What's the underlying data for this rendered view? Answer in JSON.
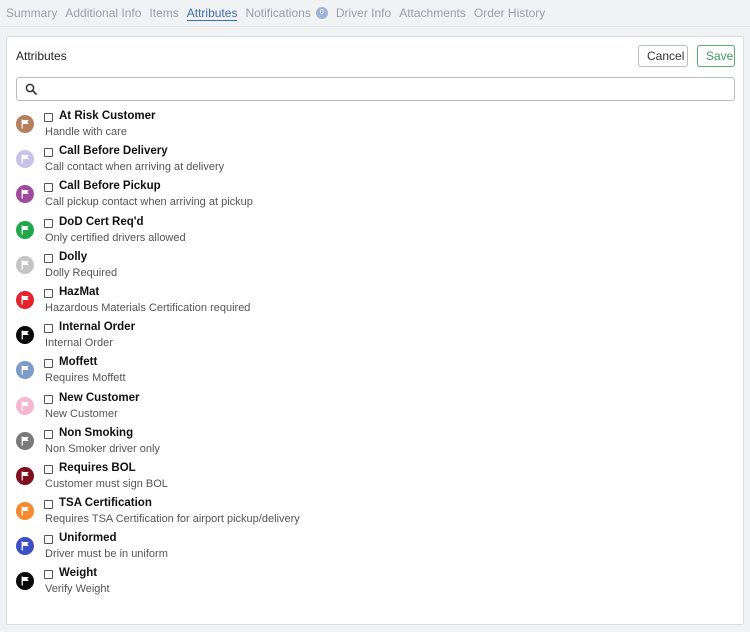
{
  "tabs": [
    {
      "label": "Summary"
    },
    {
      "label": "Additional Info"
    },
    {
      "label": "Items"
    },
    {
      "label": "Attributes",
      "active": true
    },
    {
      "label": "Notifications",
      "badge": "0"
    },
    {
      "label": "Driver Info"
    },
    {
      "label": "Attachments"
    },
    {
      "label": "Order History"
    }
  ],
  "panel": {
    "title": "Attributes",
    "cancel_label": "Cancel",
    "save_label": "Save",
    "search": {
      "value": "",
      "placeholder": ""
    }
  },
  "attributes": [
    {
      "name": "At Risk Customer",
      "description": "Handle with care",
      "color": "#b87f5e",
      "flag": "#ffffff",
      "checked": false
    },
    {
      "name": "Call Before Delivery",
      "description": "Call contact when arriving at delivery",
      "color": "#c9c2e8",
      "flag": "#ffffff",
      "checked": false
    },
    {
      "name": "Call Before Pickup",
      "description": "Call pickup contact when arriving at pickup",
      "color": "#a04ba0",
      "flag": "#ffffff",
      "checked": false
    },
    {
      "name": "DoD Cert Req'd",
      "description": "Only certified drivers allowed",
      "color": "#1fa84a",
      "flag": "#ffffff",
      "checked": false
    },
    {
      "name": "Dolly",
      "description": "Dolly Required",
      "color": "#c4c4c4",
      "flag": "#ffffff",
      "checked": false
    },
    {
      "name": "HazMat",
      "description": "Hazardous Materials Certification required",
      "color": "#e3232e",
      "flag": "#ffffff",
      "checked": false
    },
    {
      "name": "Internal Order",
      "description": "Internal Order",
      "color": "#0a0a0a",
      "flag": "#ffffff",
      "checked": false
    },
    {
      "name": "Moffett",
      "description": "Requires Moffett",
      "color": "#7a9cc6",
      "flag": "#ffffff",
      "checked": false
    },
    {
      "name": "New Customer",
      "description": "New Customer",
      "color": "#f5b8cf",
      "flag": "#ffffff",
      "checked": false
    },
    {
      "name": "Non Smoking",
      "description": "Non Smoker driver only",
      "color": "#7a7a7a",
      "flag": "#ffffff",
      "checked": false
    },
    {
      "name": "Requires BOL",
      "description": "Customer must sign BOL",
      "color": "#7d0f1f",
      "flag": "#ffffff",
      "checked": false
    },
    {
      "name": "TSA Certification",
      "description": "Requires TSA Certification for airport pickup/delivery",
      "color": "#f7892f",
      "flag": "#ffffff",
      "checked": false
    },
    {
      "name": "Uniformed",
      "description": "Driver must be in uniform",
      "color": "#3e4fc4",
      "flag": "#ffffff",
      "checked": false
    },
    {
      "name": "Weight",
      "description": "Verify Weight",
      "color": "#0a0a0a",
      "flag": "#ffffff",
      "checked": false
    }
  ]
}
